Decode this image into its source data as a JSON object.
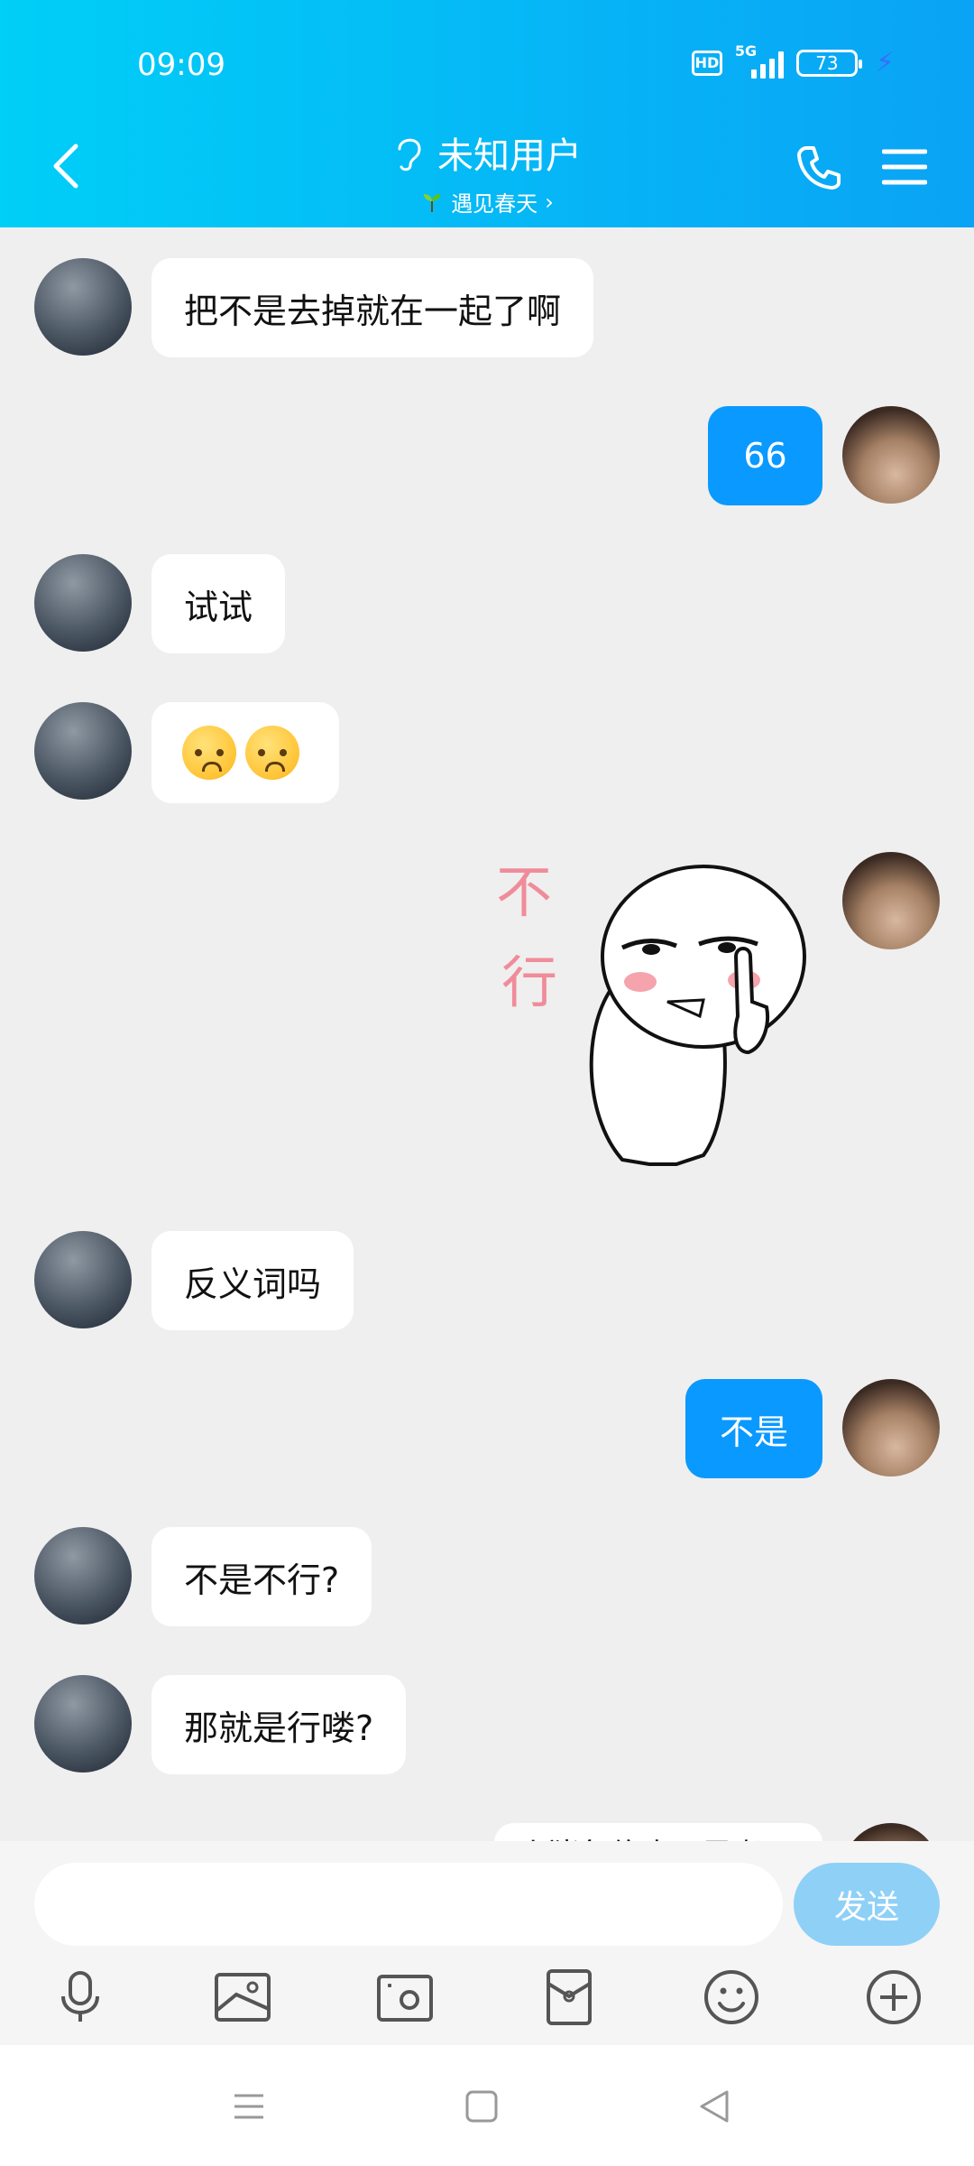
{
  "status_bar": {
    "time": "09:09",
    "hd_label": "HD",
    "network_label": "5G",
    "battery": "73"
  },
  "header": {
    "title": "未知用户",
    "subtitle": "遇见春天"
  },
  "messages": [
    {
      "side": "in",
      "text": "把不是去掉就在一起了啊"
    },
    {
      "side": "out",
      "text": "66"
    },
    {
      "side": "in",
      "text": "试试"
    },
    {
      "side": "in",
      "text": "emoji",
      "emoji": [
        "worried-face",
        "worried-face"
      ]
    },
    {
      "side": "out",
      "text": "sticker",
      "sticker_text": "不行"
    },
    {
      "side": "in",
      "text": "反义词吗"
    },
    {
      "side": "out",
      "text": "不是"
    },
    {
      "side": "in",
      "text": "不是不行?"
    },
    {
      "side": "in",
      "text": "那就是行喽?"
    },
    {
      "side": "out",
      "text": "小猪急停止了思考"
    }
  ],
  "composer": {
    "input_value": "",
    "send_label": "发送"
  },
  "toolbar": [
    "microphone-icon",
    "image-icon",
    "camera-icon",
    "red-packet-icon",
    "emoji-icon",
    "plus-icon"
  ],
  "navbar": [
    "recent-apps-icon",
    "home-icon",
    "back-icon"
  ],
  "colors": {
    "header_start": "#00cff7",
    "header_end": "#0aa3f5",
    "out_bubble": "#0a99ff",
    "send_button": "#8fd0f7",
    "chat_bg": "#efefef"
  }
}
